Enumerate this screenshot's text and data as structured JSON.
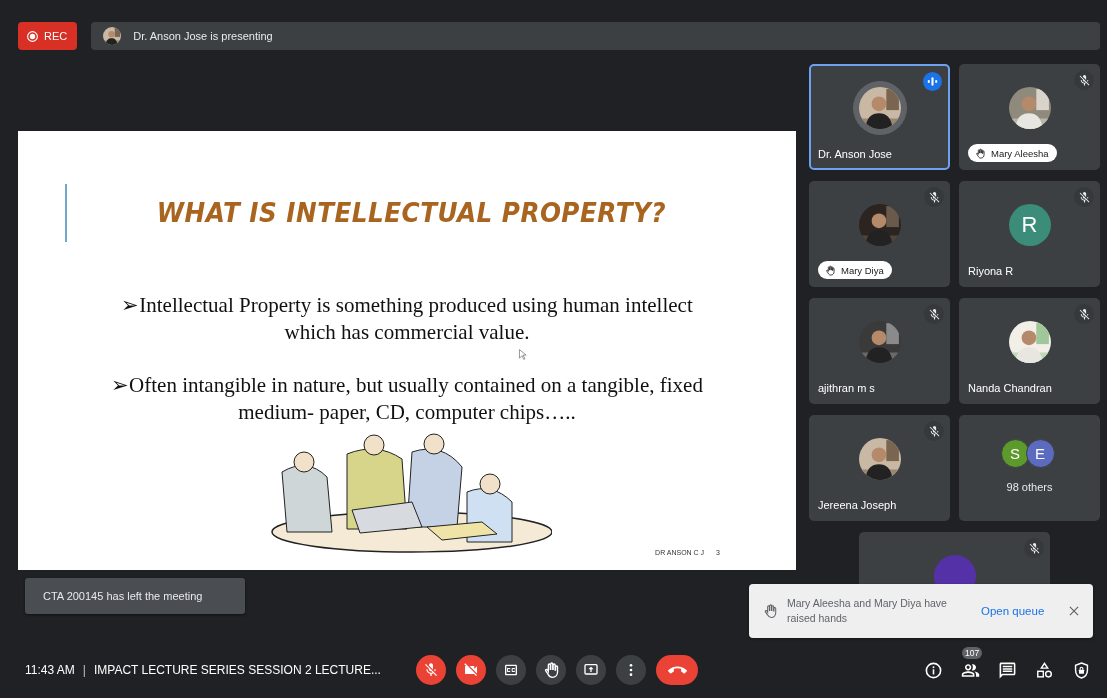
{
  "recording": {
    "label": "REC"
  },
  "presenter_bar": {
    "text": "Dr. Anson Jose is presenting"
  },
  "slide": {
    "title": "WHAT IS INTELLECTUAL PROPERTY?",
    "bullet_mark": "➢",
    "bullets": [
      "Intellectual Property is something produced using human intellect which has commercial value.",
      "Often intangible in nature, but usually contained on a tangible, fixed medium- paper, CD, computer chips….."
    ],
    "footer": "DR ANSON C J",
    "page": "3"
  },
  "tiles": [
    {
      "name": "Dr. Anson Jose",
      "speaking": true,
      "muted": false,
      "hand_raised": false
    },
    {
      "name": "Mary Aleesha",
      "speaking": false,
      "muted": true,
      "hand_raised": true
    },
    {
      "name": "Mary Diya",
      "speaking": false,
      "muted": true,
      "hand_raised": true
    },
    {
      "kind": "letter",
      "letter": "R",
      "color": "#3b8c78",
      "name": "Riyona R",
      "speaking": false,
      "muted": true,
      "hand_raised": false
    },
    {
      "name": "ajithran m s",
      "speaking": false,
      "muted": true,
      "hand_raised": false
    },
    {
      "name": "Nanda Chandran",
      "speaking": false,
      "muted": true,
      "hand_raised": false
    },
    {
      "name": "Jereena Joseph",
      "speaking": false,
      "muted": true,
      "hand_raised": false
    },
    {
      "kind": "others",
      "avatars": [
        {
          "letter": "S",
          "color": "#5c9a2b"
        },
        {
          "letter": "E",
          "color": "#5c6bc0"
        }
      ],
      "name": "98 others",
      "speaking": false,
      "muted": false,
      "hand_raised": false
    },
    {
      "kind": "letter",
      "color": "#5531a8",
      "speaking": false,
      "muted": true
    }
  ],
  "left_toast": {
    "text": "CTA 200145 has left the meeting"
  },
  "hand_toast": {
    "text": "Mary Aleesha and Mary Diya have raised hands",
    "action": "Open queue"
  },
  "footer": {
    "time": "11:43 AM",
    "separator": "|",
    "meeting_title": "IMPACT LECTURE SERIES SESSION 2 LECTURE..."
  },
  "controls": [
    {
      "kind": "mic",
      "on": false
    },
    {
      "kind": "camera",
      "on": false
    },
    {
      "kind": "captions",
      "on": false
    },
    {
      "kind": "hand",
      "on": false
    },
    {
      "kind": "present"
    },
    {
      "kind": "more"
    },
    {
      "kind": "end"
    }
  ],
  "side_buttons": [
    {
      "kind": "info"
    },
    {
      "kind": "people",
      "badge": "107"
    },
    {
      "kind": "chat"
    },
    {
      "kind": "activities"
    },
    {
      "kind": "lock"
    }
  ]
}
